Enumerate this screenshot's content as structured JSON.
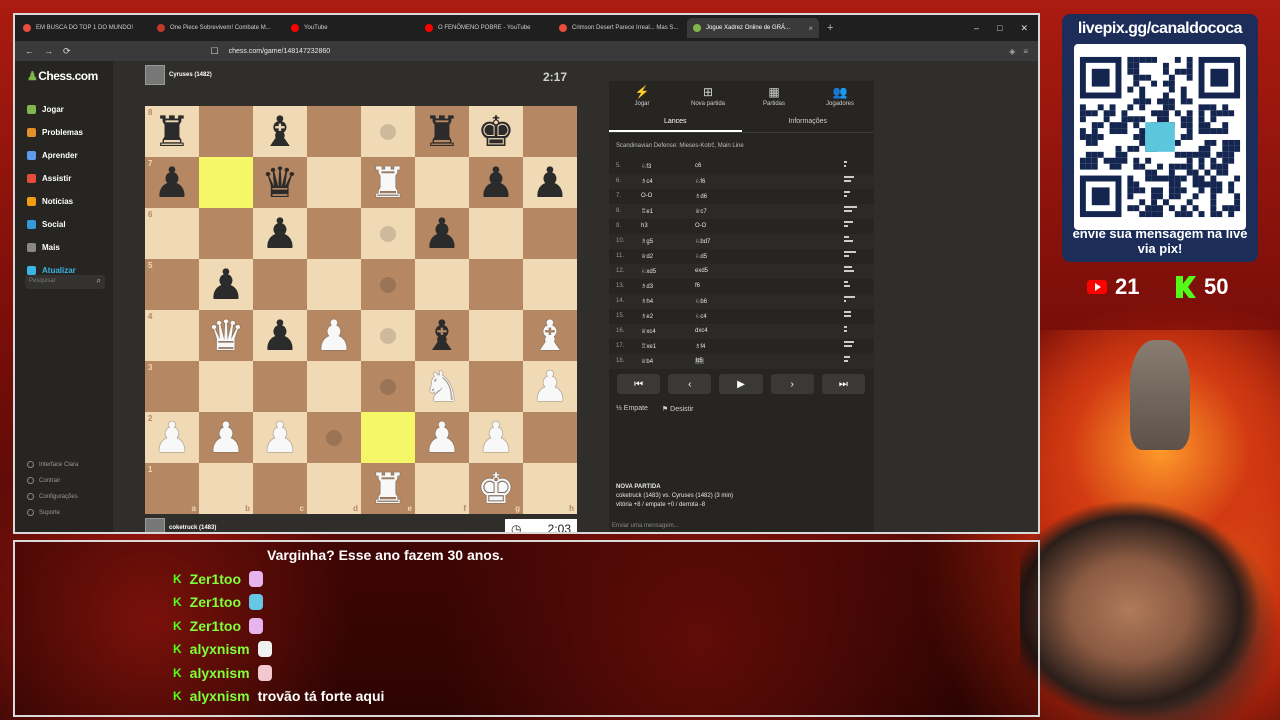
{
  "browser": {
    "tabs": [
      {
        "label": "EM BUSCA DO TOP 1 DO MUNDO!",
        "color": "#e74c3c"
      },
      {
        "label": "One Piece Sobrevivem! Combate M...",
        "color": "#c0392b"
      },
      {
        "label": "YouTube",
        "color": "#ff0000"
      },
      {
        "label": "O FENÔMENO POBRE - YouTube",
        "color": "#ff0000"
      },
      {
        "label": "Crimson Desert Parece Irreal... Mas S...",
        "color": "#e74c3c"
      },
      {
        "label": "Jogue Xadrez Online de GRÁ...",
        "color": "#81b64c",
        "active": true
      }
    ],
    "url": "chess.com/game/148147232860"
  },
  "sidebar": {
    "logo": "Chess.com",
    "items": [
      {
        "label": "Jogar",
        "color": "#81b64c"
      },
      {
        "label": "Problemas",
        "color": "#e58f2a"
      },
      {
        "label": "Aprender",
        "color": "#5d9cec"
      },
      {
        "label": "Assistir",
        "color": "#e74c3c"
      },
      {
        "label": "Notícias",
        "color": "#f39c12"
      },
      {
        "label": "Social",
        "color": "#3498db"
      },
      {
        "label": "Mais",
        "color": "#888888"
      },
      {
        "label": "Atualizar",
        "color": "#3cb4e6"
      }
    ],
    "search_placeholder": "Pesquisar",
    "bottom": [
      "Interface Clara",
      "Contrair",
      "Configurações",
      "Suporte"
    ]
  },
  "game": {
    "top_player": {
      "name": "Cyruses (1482)",
      "time": "2:17"
    },
    "bottom_player": {
      "name": "coketruck (1483)",
      "time": "2:03"
    },
    "board": {
      "files": [
        "a",
        "b",
        "c",
        "d",
        "e",
        "f",
        "g",
        "h"
      ],
      "ranks": [
        "8",
        "7",
        "6",
        "5",
        "4",
        "3",
        "2",
        "1"
      ],
      "pieces": [
        [
          "b:r",
          "",
          "b:b",
          "",
          "",
          "b:r",
          "b:k",
          ""
        ],
        [
          "b:p",
          "",
          "b:q",
          "",
          "w:r",
          "",
          "b:p",
          "b:p"
        ],
        [
          "",
          "",
          "b:p",
          "",
          "",
          "b:p",
          "",
          ""
        ],
        [
          "",
          "b:p",
          "",
          "",
          "",
          "",
          "",
          ""
        ],
        [
          "",
          "w:q",
          "b:p",
          "w:p",
          "",
          "b:b",
          "",
          "w:b"
        ],
        [
          "",
          "",
          "",
          "",
          "",
          "w:n",
          "",
          "w:p"
        ],
        [
          "w:p",
          "w:p",
          "w:p",
          "",
          "",
          "w:p",
          "w:p",
          ""
        ],
        [
          "",
          "",
          "",
          "",
          "w:r",
          "",
          "w:k",
          ""
        ]
      ],
      "highlights": [
        "b7",
        "e2"
      ],
      "dots": [
        "e8",
        "e6",
        "e5",
        "e4",
        "e3",
        "d2"
      ]
    }
  },
  "panel": {
    "tabs": [
      "Jogar",
      "Nova partida",
      "Partidas",
      "Jogadores"
    ],
    "subtabs": [
      "Lances",
      "Informações"
    ],
    "opening": "Scandinavian Defense: Mieses-Kotrč, Main Line",
    "moves": [
      {
        "n": "5.",
        "w": "♘f3",
        "b": "c6"
      },
      {
        "n": "6.",
        "w": "♗c4",
        "b": "♘f6"
      },
      {
        "n": "7.",
        "w": "O-O",
        "b": "♗d6"
      },
      {
        "n": "8.",
        "w": "♖e1",
        "b": "♕c7"
      },
      {
        "n": "9.",
        "w": "h3",
        "b": "O-O"
      },
      {
        "n": "10.",
        "w": "♗g5",
        "b": "♘bd7"
      },
      {
        "n": "11.",
        "w": "♕d2",
        "b": "♘d5"
      },
      {
        "n": "12.",
        "w": "♘xd5",
        "b": "exd5"
      },
      {
        "n": "13.",
        "w": "♗d3",
        "b": "f6"
      },
      {
        "n": "14.",
        "w": "♗h4",
        "b": "♘b6"
      },
      {
        "n": "15.",
        "w": "♗e2",
        "b": "♘c4"
      },
      {
        "n": "16.",
        "w": "♕xc4",
        "b": "dxc4"
      },
      {
        "n": "17.",
        "w": "♖xe1",
        "b": "♗f4"
      },
      {
        "n": "18.",
        "w": "♕b4",
        "b": "b5"
      }
    ],
    "draw_label": "Empate",
    "resign_label": "Desistir",
    "new_game_title": "NOVA PARTIDA",
    "new_game_line1": "coketruck (1483) vs. Cyruses (1482) (3 min)",
    "new_game_line2": "vitória +8 / empate +0 / derrota -8",
    "chat_placeholder": "Enviar uma mensagem..."
  },
  "overlay": {
    "livepix_url": "livepix.gg/canaldococa",
    "livepix_msg": "envie sua mensagem na live via pix!",
    "youtube_viewers": "21",
    "kick_viewers": "50"
  },
  "chat": [
    {
      "user": "",
      "text": "Varginha? Esse ano fazem 30 anos.",
      "emote": ""
    },
    {
      "user": "Zer1too",
      "text": "",
      "emote": "#e8b4f0"
    },
    {
      "user": "Zer1too",
      "text": "",
      "emote": "#66c6e6"
    },
    {
      "user": "Zer1too",
      "text": "",
      "emote": "#e8b4f0"
    },
    {
      "user": "alyxnism",
      "text": "",
      "emote": "#f0f0f0"
    },
    {
      "user": "alyxnism",
      "text": "",
      "emote": "#f2c8d0"
    },
    {
      "user": "alyxnism",
      "text": "trovão tá forte aqui",
      "emote": ""
    }
  ]
}
